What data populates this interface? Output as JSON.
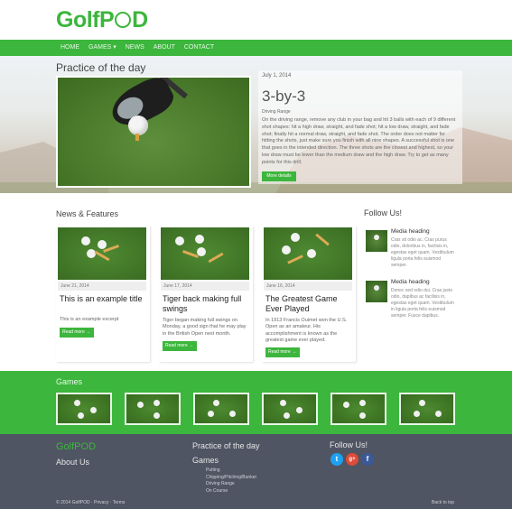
{
  "header": {
    "logo_prefix": "GolfP",
    "logo_suffix": "D"
  },
  "nav": {
    "items": [
      "Home",
      "Games ▾",
      "News",
      "About",
      "Contact"
    ]
  },
  "hero": {
    "section_title": "Practice of the day",
    "date": "July 1, 2014",
    "title": "3-by-3",
    "category": "Driving Range",
    "text": "On the driving range, remove any club in your bag and hit 3 balls with each of 9 different shot shapes: hit a high draw, straight, and fade shot; hit a low draw, straight, and fade shot; finally hit a normal draw, straight, and fade shot. The order does not matter for hitting the shots, just make sure you finish with all nine shapes. A successful shot is one that goes in the intended direction. The three shots are the closest and highest, so your low draw must be lower than the medium draw and the high draw. Try to get as many points for this drill.",
    "button": "More details"
  },
  "news": {
    "section_title": "News & Features",
    "cards": [
      {
        "date": "June 21, 2014",
        "title": "This is an example title",
        "desc": "This is an example excerpt",
        "more": "Read more →"
      },
      {
        "date": "June 17, 2014",
        "title": "Tiger back making full swings",
        "desc": "Tiger began making full swings on Monday, a good sign that he may play in the British Open next month.",
        "more": "Read more →"
      },
      {
        "date": "June 16, 2014",
        "title": "The Greatest Game Ever Played",
        "desc": "In 1913 Francis Ouimet won the U.S. Open as an amateur. His accomplishment is known as the greatest game ever played.",
        "more": "Read more →"
      }
    ]
  },
  "follow": {
    "title": "Follow Us!",
    "media": [
      {
        "heading": "Media heading",
        "text": "Cras sit odio ac. Cras purus odio, doloribus in, facilisis in, egestas eget quam. Vestibulum ligula porta felis euismod semper."
      },
      {
        "heading": "Media heading",
        "text": "Donec sed odio dui. Cras justo odio, dapibus ac facilisis in, egestas eget quam. Vestibulum in ligula porta felis euismod semper. Fusce dapibus."
      }
    ]
  },
  "games": {
    "title": "Games"
  },
  "footer": {
    "brand": "GolfPOD",
    "about": "About Us",
    "practice": "Practice of the day",
    "games": "Games",
    "game_list": [
      "Putting",
      "Chipping/Pitching/Bunker",
      "Driving Range",
      "On Course"
    ],
    "follow": "Follow Us!",
    "social": [
      "t",
      "g+",
      "f"
    ],
    "copyright": "© 2014 GolfPOD · Privacy · Terms",
    "back_to_top": "Back to top"
  },
  "colors": {
    "brand_green": "#3cb63c",
    "footer_bg": "#4f5563",
    "twitter": "#1da1f2",
    "gplus": "#dd4b39",
    "facebook": "#3b5998"
  }
}
